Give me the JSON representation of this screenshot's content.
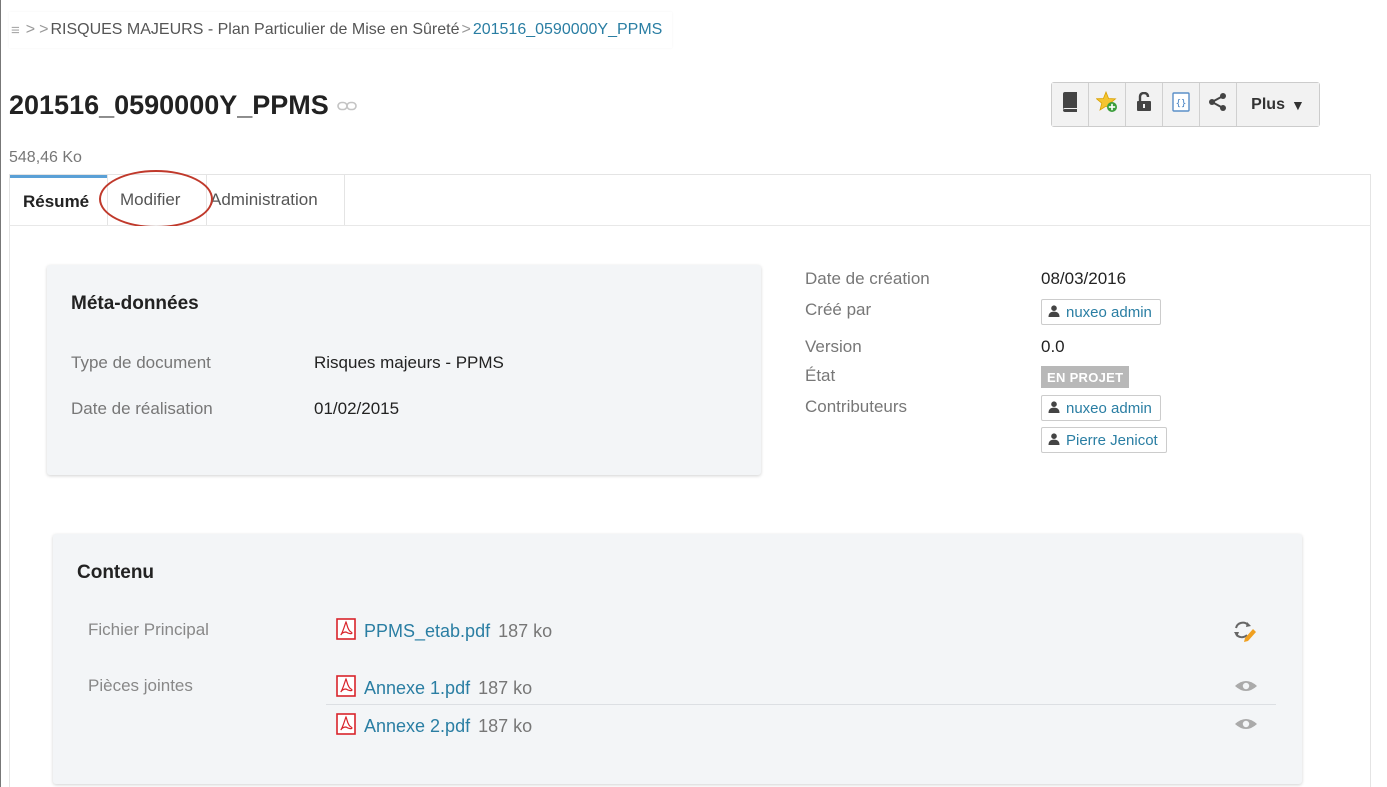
{
  "breadcrumb": {
    "menu_icon": "≡",
    "sep1": ">",
    "sep2": ">",
    "parent": "RISQUES MAJEURS - Plan Particulier de Mise en Sûreté",
    "sep3": ">",
    "current": "201516_0590000Y_PPMS"
  },
  "document": {
    "title": "201516_0590000Y_PPMS",
    "size": "548,46 Ko"
  },
  "toolbar": {
    "buttons": [
      "book-icon",
      "add-favorite-icon",
      "unlock-icon",
      "json-export-icon",
      "share-icon"
    ],
    "plus_label": "Plus",
    "plus_caret": "▼"
  },
  "tabs": {
    "summary": "Résumé",
    "edit": "Modifier",
    "admin": "Administration"
  },
  "metadata": {
    "title": "Méta-données",
    "type_label": "Type de document",
    "type_value": "Risques majeurs - PPMS",
    "date_label": "Date de réalisation",
    "date_value": "01/02/2015"
  },
  "info": {
    "created_label": "Date de création",
    "created_value": "08/03/2016",
    "author_label": "Créé par",
    "author_value": "nuxeo admin",
    "version_label": "Version",
    "version_value": "0.0",
    "state_label": "État",
    "state_value": "EN PROJET",
    "contributors_label": "Contributeurs",
    "contributors": [
      "nuxeo admin",
      "Pierre Jenicot"
    ]
  },
  "content": {
    "title": "Contenu",
    "main_label": "Fichier Principal",
    "main_file": {
      "name": "PPMS_etab.pdf",
      "size": "187 ko"
    },
    "attachments_label": "Pièces jointes",
    "attachments": [
      {
        "name": "Annexe 1.pdf",
        "size": "187 ko"
      },
      {
        "name": "Annexe 2.pdf",
        "size": "187 ko"
      }
    ]
  },
  "colors": {
    "link": "#2a7ea3",
    "active_tab": "#5aa0d6",
    "annotation": "#c0392b",
    "state_badge": "#b8b8b8",
    "pdf_icon": "#d9242b"
  }
}
